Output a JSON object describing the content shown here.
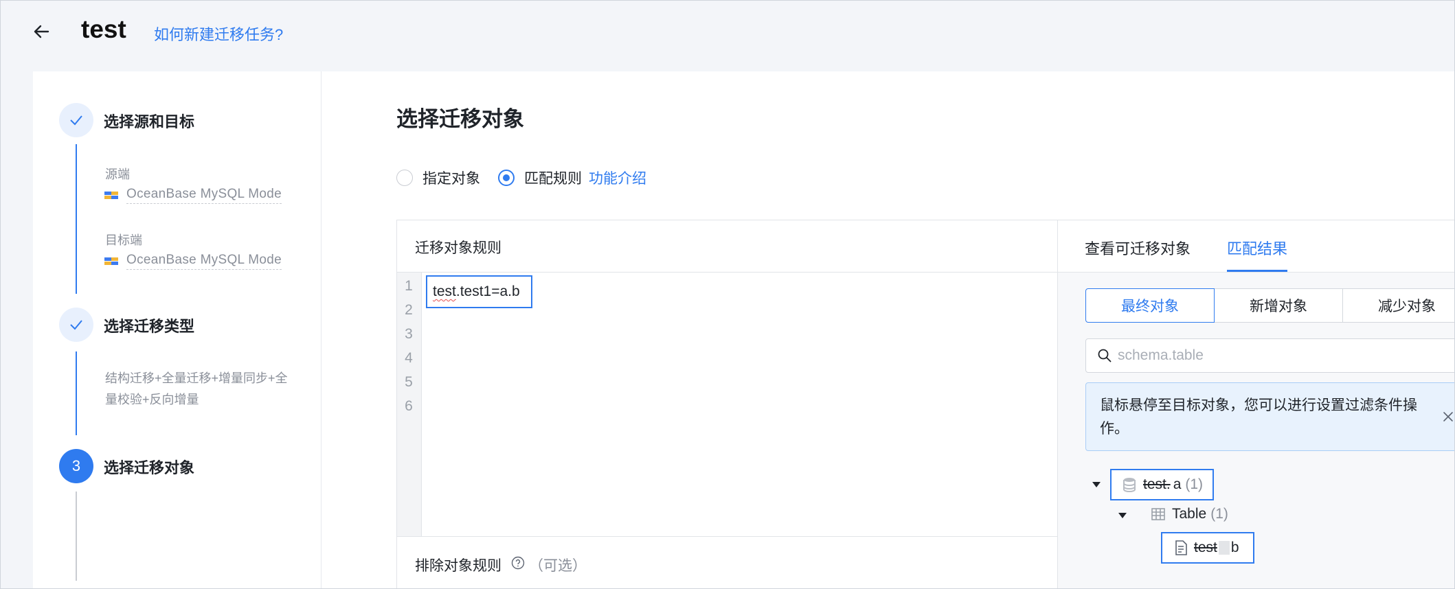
{
  "header": {
    "title": "test",
    "help_link": "如何新建迁移任务?"
  },
  "steps": [
    {
      "title": "选择源和目标",
      "status": "done",
      "source_label": "源端",
      "source_db": "OceanBase MySQL Mode",
      "target_label": "目标端",
      "target_db": "OceanBase MySQL Mode"
    },
    {
      "title": "选择迁移类型",
      "status": "done",
      "description": "结构迁移+全量迁移+增量同步+全量校验+反向增量"
    },
    {
      "number": "3",
      "title": "选择迁移对象",
      "status": "active"
    }
  ],
  "content": {
    "title": "选择迁移对象",
    "radio_specify": "指定对象",
    "radio_match": "匹配规则",
    "feature_link": "功能介绍",
    "rules_header": "迁移对象规则",
    "line_numbers": [
      "1",
      "2",
      "3",
      "4",
      "5",
      "6"
    ],
    "rule_line_prefix": "test",
    "rule_line_rest": ".test1=a.b",
    "exclude_label": "排除对象规则",
    "exclude_optional": "（可选）"
  },
  "results": {
    "tab_view": "查看可迁移对象",
    "tab_match": "匹配结果",
    "seg_final": "最终对象",
    "seg_added": "新增对象",
    "seg_reduced": "减少对象",
    "search_placeholder": "schema.table",
    "notice": "鼠标悬停至目标对象，您可以进行设置过滤条件操作。",
    "tree": {
      "db_old": "test.",
      "db_new": "a",
      "db_count": "(1)",
      "group": "Table",
      "group_count": "(1)",
      "table_old": "test",
      "table_new": "b"
    }
  },
  "colors": {
    "primary": "#2f7bef",
    "border": "#e1e4e8",
    "muted": "#8a8f99"
  }
}
